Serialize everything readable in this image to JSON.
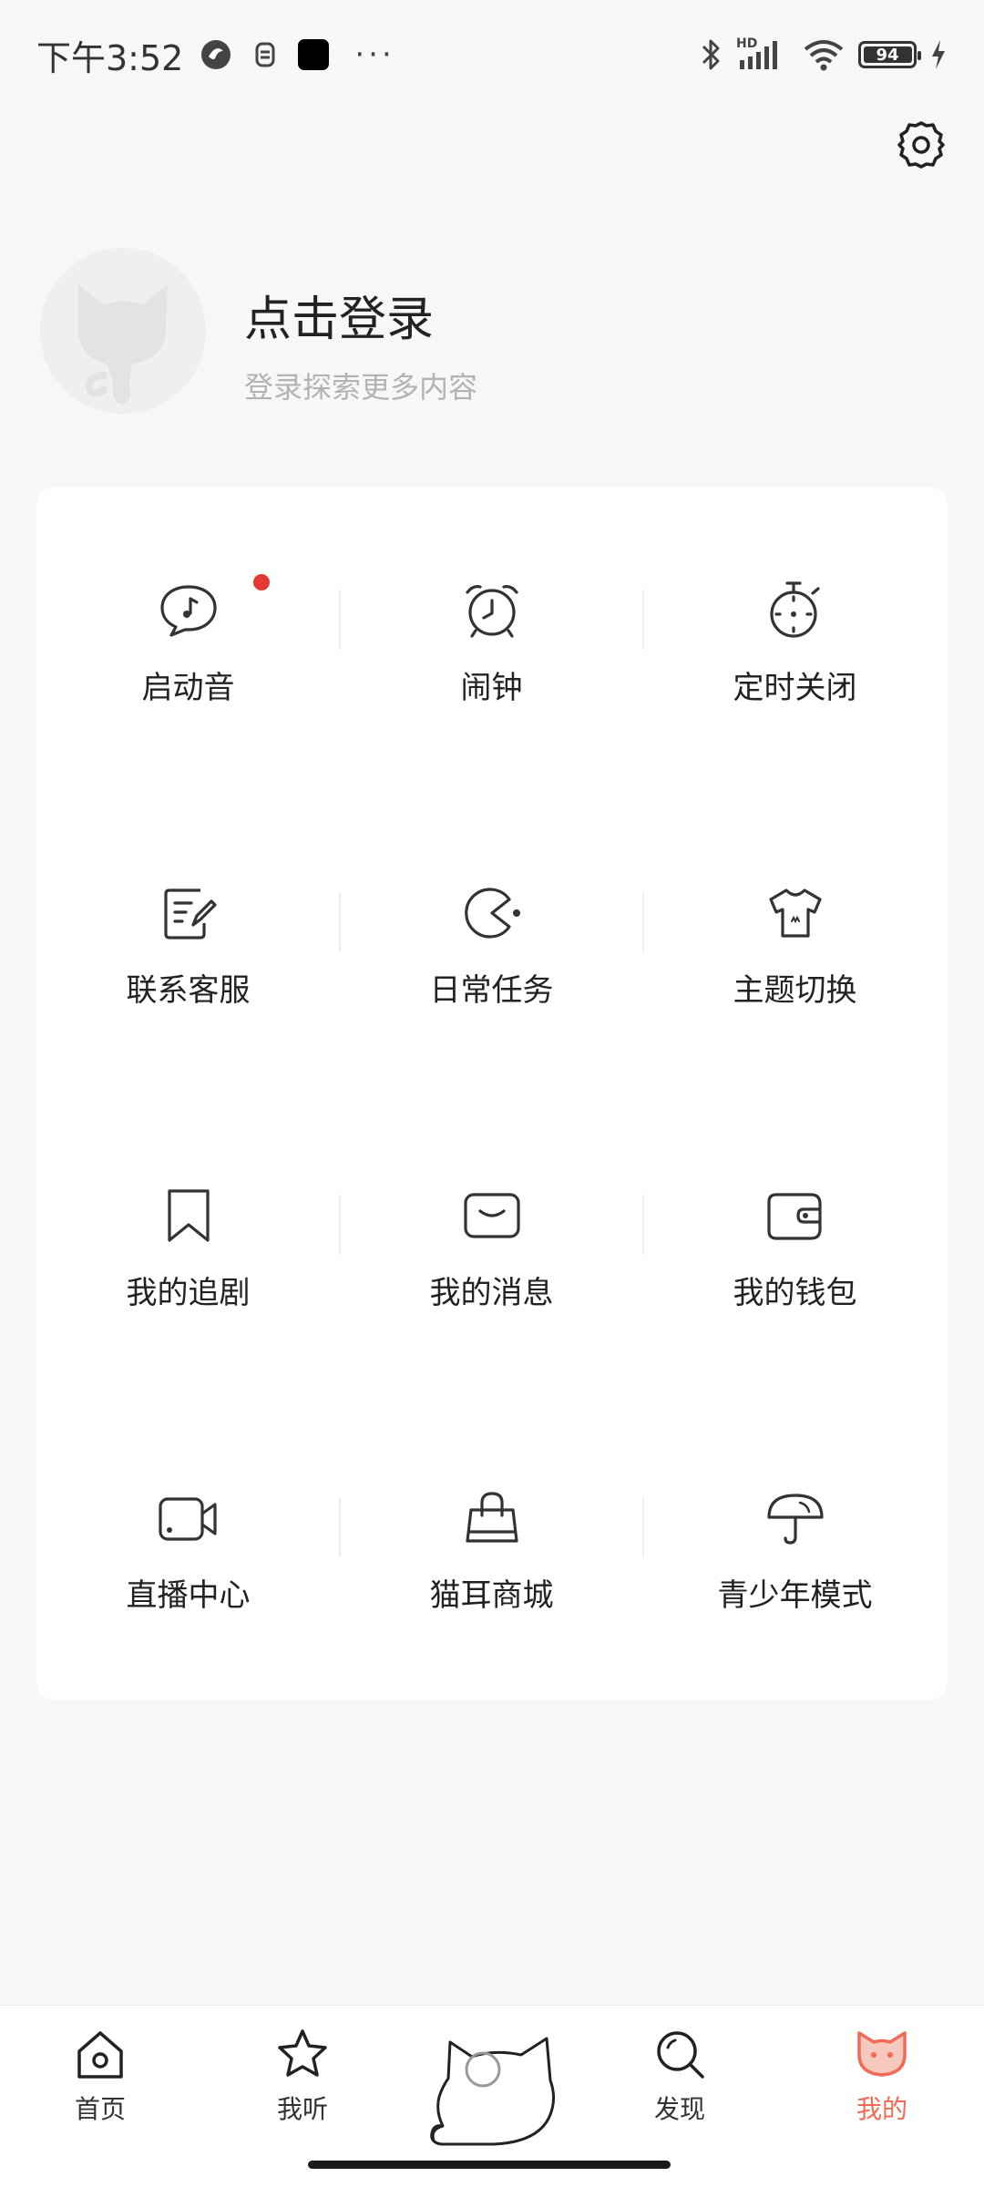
{
  "status_bar": {
    "time": "下午3:52",
    "battery": "94",
    "network_label": "HD"
  },
  "profile": {
    "title": "点击登录",
    "subtitle": "登录探索更多内容"
  },
  "grid": [
    {
      "label": "启动音",
      "icon": "speech-music-icon"
    },
    {
      "label": "闹钟",
      "icon": "alarm-clock-icon"
    },
    {
      "label": "定时关闭",
      "icon": "timer-icon"
    },
    {
      "label": "联系客服",
      "icon": "edit-note-icon"
    },
    {
      "label": "日常任务",
      "icon": "pacman-icon"
    },
    {
      "label": "主题切换",
      "icon": "tshirt-icon"
    },
    {
      "label": "我的追剧",
      "icon": "bookmark-icon"
    },
    {
      "label": "我的消息",
      "icon": "message-icon"
    },
    {
      "label": "我的钱包",
      "icon": "wallet-icon"
    },
    {
      "label": "直播中心",
      "icon": "video-camera-icon"
    },
    {
      "label": "猫耳商城",
      "icon": "shopping-bag-icon"
    },
    {
      "label": "青少年模式",
      "icon": "umbrella-icon"
    }
  ],
  "bottom_nav": [
    {
      "label": "首页",
      "icon": "home-icon"
    },
    {
      "label": "我听",
      "icon": "star-icon"
    },
    {
      "label": "发现",
      "icon": "search-icon"
    },
    {
      "label": "我的",
      "icon": "cat-face-icon"
    }
  ],
  "colors": {
    "accent": "#f06a55",
    "notification": "#e53935",
    "background": "#f7f7f7"
  }
}
